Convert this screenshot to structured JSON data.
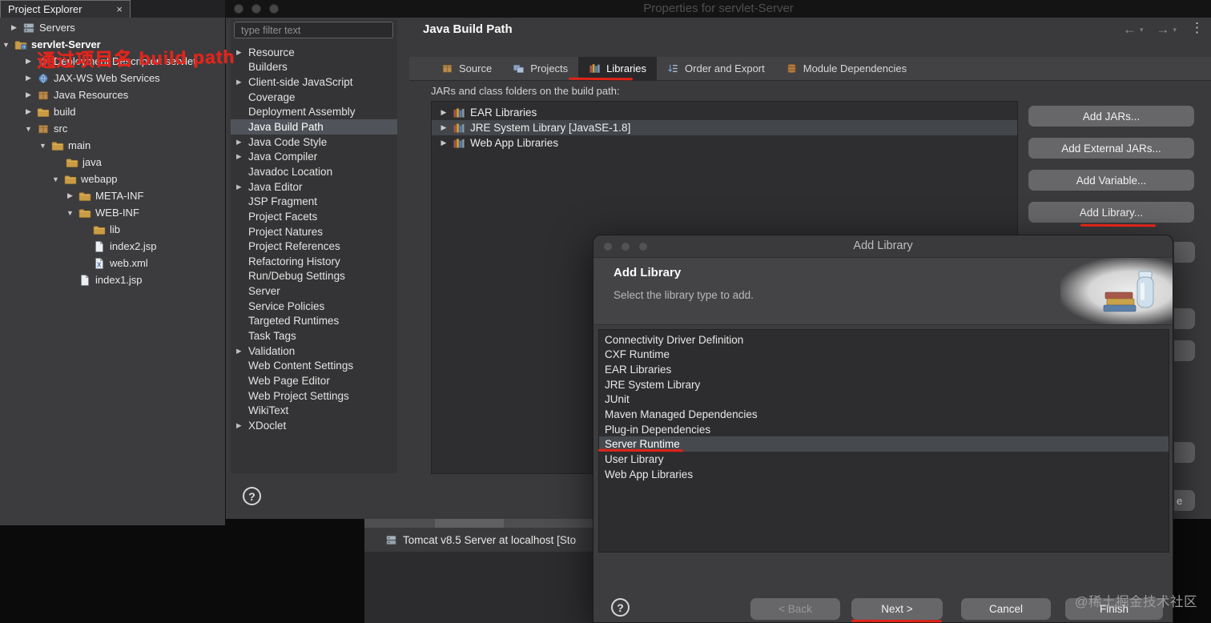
{
  "window": {
    "title": "Properties for servlet-Server",
    "explorer_tab": "Project Explorer"
  },
  "icons": {
    "collapsed_arrow": "▶",
    "expanded_arrow": "▼",
    "close": "×",
    "back": "←",
    "forward": "→",
    "caret": "▾",
    "menu": "⋮",
    "help": "?"
  },
  "annotations": {
    "note_text": "通过项目名 build path"
  },
  "explorer": {
    "items": [
      {
        "label": "Servers"
      },
      {
        "label": "servlet-Server"
      },
      {
        "label": "Deployment Descriptor: servlet"
      },
      {
        "label": "JAX-WS Web Services"
      },
      {
        "label": "Java Resources"
      },
      {
        "label": "build"
      },
      {
        "label": "src"
      },
      {
        "label": "main"
      },
      {
        "label": "java"
      },
      {
        "label": "webapp"
      },
      {
        "label": "META-INF"
      },
      {
        "label": "WEB-INF"
      },
      {
        "label": "lib"
      },
      {
        "label": "index2.jsp"
      },
      {
        "label": "web.xml"
      },
      {
        "label": "index1.jsp"
      }
    ]
  },
  "properties": {
    "filter_placeholder": "type filter text",
    "nav_items": [
      "Resource",
      "Builders",
      "Client-side JavaScript",
      "Coverage",
      "Deployment Assembly",
      "Java Build Path",
      "Java Code Style",
      "Java Compiler",
      "Javadoc Location",
      "Java Editor",
      "JSP Fragment",
      "Project Facets",
      "Project Natures",
      "Project References",
      "Refactoring History",
      "Run/Debug Settings",
      "Server",
      "Service Policies",
      "Targeted Runtimes",
      "Task Tags",
      "Validation",
      "Web Content Settings",
      "Web Page Editor",
      "Web Project Settings",
      "WikiText",
      "XDoclet"
    ],
    "selected_nav_item": "Java Build Path",
    "page_title": "Java Build Path",
    "tabs": [
      "Source",
      "Projects",
      "Libraries",
      "Order and Export",
      "Module Dependencies"
    ],
    "selected_tab": "Libraries",
    "list_caption": "JARs and class folders on the build path:",
    "build_path_items": [
      "EAR Libraries",
      "JRE System Library [JavaSE-1.8]",
      "Web App Libraries"
    ],
    "buttons": [
      "Add JARs...",
      "Add External JARs...",
      "Add Variable...",
      "Add Library..."
    ],
    "partial_button_label": "e"
  },
  "add_library_dialog": {
    "title": "Add Library",
    "heading": "Add Library",
    "subtitle": "Select the library type to add.",
    "options": [
      "Connectivity Driver Definition",
      "CXF Runtime",
      "EAR Libraries",
      "JRE System Library",
      "JUnit",
      "Maven Managed Dependencies",
      "Plug-in Dependencies",
      "Server Runtime",
      "User Library",
      "Web App Libraries"
    ],
    "selected_option": "Server Runtime",
    "back_label": "< Back",
    "next_label": "Next >",
    "cancel_label": "Cancel",
    "finish_label": "Finish"
  },
  "servers_view": {
    "tomcat_label": "Tomcat v8.5 Server at localhost  [Sto"
  },
  "watermark": "@稀土掘金技术社区",
  "colors": {
    "annotation_red": "#e02318",
    "panel_dark": "#3a3a3c",
    "list_dark": "#2d2d2f",
    "selection_gray": "#50545a"
  }
}
